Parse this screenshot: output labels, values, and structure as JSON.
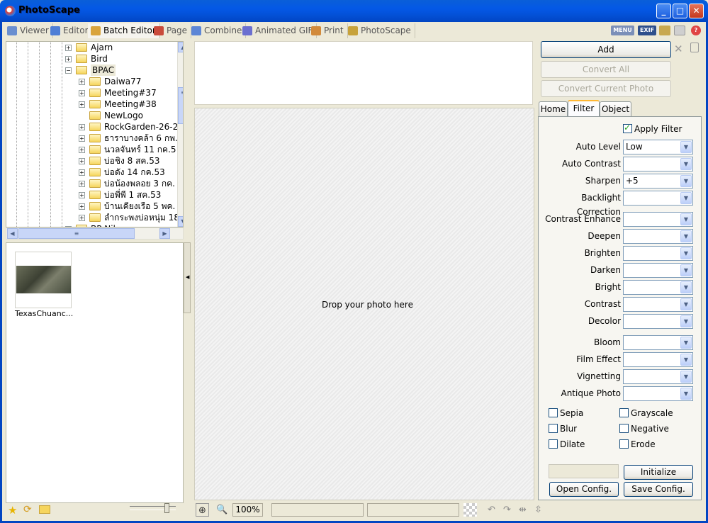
{
  "window": {
    "title": "PhotoScape"
  },
  "tabs": [
    {
      "label": "Viewer",
      "color": "#6a8fd0"
    },
    {
      "label": "Editor",
      "color": "#4f7fd6"
    },
    {
      "label": "Batch Editor",
      "color": "#d9a43c"
    },
    {
      "label": "Page",
      "color": "#c94b3b"
    },
    {
      "label": "Combine",
      "color": "#5d86d6"
    },
    {
      "label": "Animated GIF",
      "color": "#6b6fd0"
    },
    {
      "label": "Print",
      "color": "#d28a3a"
    },
    {
      "label": "PhotoScape",
      "color": "#c7a23a"
    }
  ],
  "toolbar_right": {
    "menu": "MENU",
    "exif": "EXIF"
  },
  "tree": [
    {
      "label": "Ajarn",
      "level": 0,
      "exp": "+"
    },
    {
      "label": "Bird",
      "level": 0,
      "exp": "+"
    },
    {
      "label": "BPAC",
      "level": 0,
      "exp": "-",
      "selected": true
    },
    {
      "label": "Daiwa77",
      "level": 1,
      "exp": "+"
    },
    {
      "label": "Meeting#37",
      "level": 1,
      "exp": "+"
    },
    {
      "label": "Meeting#38",
      "level": 1,
      "exp": "+"
    },
    {
      "label": "NewLogo",
      "level": 1,
      "exp": ""
    },
    {
      "label": "RockGarden-26-2",
      "level": 1,
      "exp": "+"
    },
    {
      "label": "ธาราบางคล้า 6 กพ.",
      "level": 1,
      "exp": "+"
    },
    {
      "label": "นวลจันทร์ 11 กค.5",
      "level": 1,
      "exp": "+"
    },
    {
      "label": "บ่อชิง 8 สค.53",
      "level": 1,
      "exp": "+"
    },
    {
      "label": "บ่อดัง 14 กค.53",
      "level": 1,
      "exp": "+"
    },
    {
      "label": "บ่อน้องพลอย 3 กค.",
      "level": 1,
      "exp": "+"
    },
    {
      "label": "บ่อพี่พี 1 สค.53",
      "level": 1,
      "exp": "+"
    },
    {
      "label": "บ้านเคียงเรือ 5 พค.",
      "level": 1,
      "exp": "+"
    },
    {
      "label": "ลำกระพงบ่อหนุ่ม 18",
      "level": 1,
      "exp": "+"
    },
    {
      "label": "BP Nikon",
      "level": 0,
      "exp": "+"
    }
  ],
  "thumbnail": {
    "name": "TexasChuanc..."
  },
  "preview": {
    "drop_text": "Drop your photo here",
    "zoom": "100%"
  },
  "actions": {
    "add": "Add",
    "convert_all": "Convert All",
    "convert_current": "Convert Current Photo"
  },
  "right_tabs": [
    "Home",
    "Filter",
    "Object"
  ],
  "filter": {
    "apply_label": "Apply Filter",
    "apply_checked": true,
    "rows": [
      {
        "label": "Auto Level",
        "value": "Low"
      },
      {
        "label": "Auto Contrast",
        "value": ""
      },
      {
        "label": "Sharpen",
        "value": "+5"
      },
      {
        "label": "Backlight Correction",
        "value": ""
      },
      {
        "label": "Contrast Enhance",
        "value": ""
      },
      {
        "label": "Deepen",
        "value": ""
      },
      {
        "label": "Brighten",
        "value": ""
      },
      {
        "label": "Darken",
        "value": ""
      },
      {
        "label": "Bright",
        "value": ""
      },
      {
        "label": "Contrast",
        "value": ""
      },
      {
        "label": "Decolor",
        "value": ""
      },
      {
        "label": "Bloom",
        "value": ""
      },
      {
        "label": "Film Effect",
        "value": ""
      },
      {
        "label": "Vignetting",
        "value": ""
      },
      {
        "label": "Antique Photo",
        "value": ""
      }
    ],
    "checkboxes": [
      {
        "label": "Sepia",
        "checked": false
      },
      {
        "label": "Grayscale",
        "checked": false
      },
      {
        "label": "Blur",
        "checked": false
      },
      {
        "label": "Negative",
        "checked": false
      },
      {
        "label": "Dilate",
        "checked": false
      },
      {
        "label": "Erode",
        "checked": false
      }
    ],
    "initialize": "Initialize",
    "open_config": "Open Config.",
    "save_config": "Save Config."
  }
}
